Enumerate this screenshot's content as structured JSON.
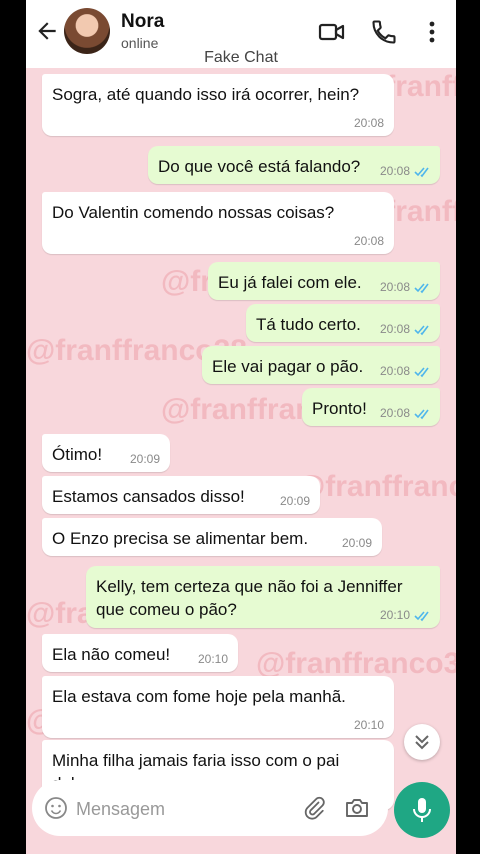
{
  "header": {
    "contact_name": "Nora",
    "status": "online",
    "app_title": "Fake Chat"
  },
  "watermark": "@franffranco38",
  "messages": [
    {
      "dir": "in",
      "text": "Sogra, até quando isso irá ocorrer, hein?",
      "time": "20:08"
    },
    {
      "dir": "out",
      "text": "Do que você está falando?",
      "time": "20:08",
      "read": true
    },
    {
      "dir": "in",
      "text": "Do Valentin comendo nossas coisas?",
      "time": "20:08"
    },
    {
      "dir": "out",
      "text": "Eu já falei com ele.",
      "time": "20:08",
      "read": true
    },
    {
      "dir": "out",
      "text": "Tá tudo certo.",
      "time": "20:08",
      "read": true
    },
    {
      "dir": "out",
      "text": "Ele vai pagar o pão.",
      "time": "20:08",
      "read": true
    },
    {
      "dir": "out",
      "text": "Pronto!",
      "time": "20:08",
      "read": true
    },
    {
      "dir": "in",
      "text": "Ótimo!",
      "time": "20:09"
    },
    {
      "dir": "in",
      "text": "Estamos cansados disso!",
      "time": "20:09"
    },
    {
      "dir": "in",
      "text": "O Enzo precisa se alimentar bem.",
      "time": "20:09"
    },
    {
      "dir": "out",
      "text": "Kelly, tem certeza que não foi a Jenniffer que comeu o pão?",
      "time": "20:10",
      "read": true
    },
    {
      "dir": "in",
      "text": "Ela não comeu!",
      "time": "20:10"
    },
    {
      "dir": "in",
      "text": "Ela estava com fome hoje pela manhã.",
      "time": "20:10"
    },
    {
      "dir": "in",
      "text": "Minha filha jamais faria isso com o pai dela.",
      "time": ""
    }
  ],
  "composer": {
    "placeholder": "Mensagem"
  },
  "colors": {
    "chat_bg": "#f8d7dc",
    "outgoing_bubble": "#e6fbd2",
    "incoming_bubble": "#ffffff",
    "read_ticks": "#4fb6ec",
    "mic_button": "#1fa784"
  }
}
